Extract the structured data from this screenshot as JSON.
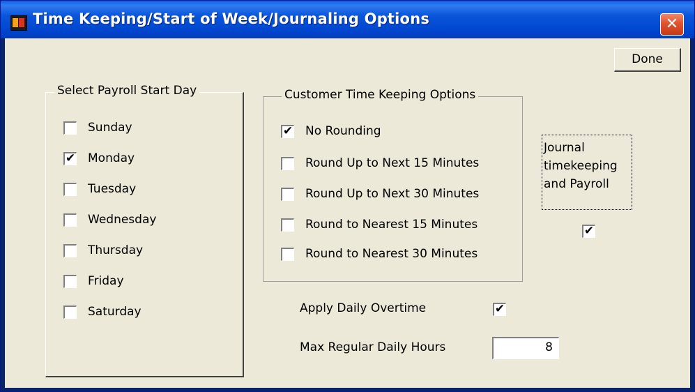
{
  "window": {
    "title": "Time Keeping/Start of Week/Journaling Options",
    "close_glyph": "✕"
  },
  "toolbar": {
    "done_label": "Done"
  },
  "payroll_start_day": {
    "legend": "Select Payroll Start Day",
    "options": [
      {
        "label": "Sunday",
        "checked": false
      },
      {
        "label": "Monday",
        "checked": true
      },
      {
        "label": "Tuesday",
        "checked": false
      },
      {
        "label": "Wednesday",
        "checked": false
      },
      {
        "label": "Thursday",
        "checked": false
      },
      {
        "label": "Friday",
        "checked": false
      },
      {
        "label": "Saturday",
        "checked": false
      }
    ]
  },
  "customer_time_keeping": {
    "legend": "Customer Time Keeping Options",
    "options": [
      {
        "label": "No Rounding",
        "checked": true
      },
      {
        "label": "Round Up to Next 15 Minutes",
        "checked": false
      },
      {
        "label": "Round Up to Next 30 Minutes",
        "checked": false
      },
      {
        "label": "Round to Nearest 15 Minutes",
        "checked": false
      },
      {
        "label": "Round to Nearest 30 Minutes",
        "checked": false
      }
    ]
  },
  "journal": {
    "lines": [
      "Journal",
      "timekeeping",
      "and Payroll"
    ],
    "checked": true
  },
  "overtime": {
    "apply_label": "Apply Daily Overtime",
    "apply_checked": true,
    "max_hours_label": "Max Regular Daily Hours",
    "max_hours_value": "8"
  },
  "checkmark": "✔",
  "colors": {
    "titlebar": "#0054e3",
    "client_bg": "#ece9d8",
    "close_button": "#e0532c"
  }
}
